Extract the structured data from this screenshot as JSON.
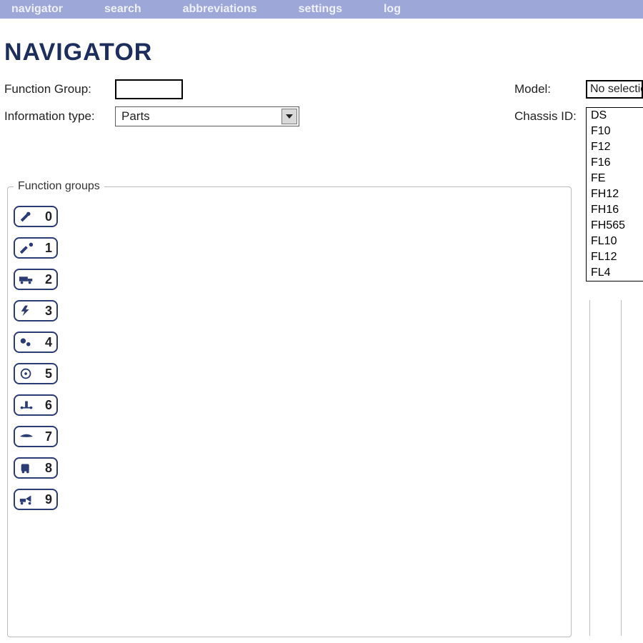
{
  "nav": {
    "items": [
      "navigator",
      "search",
      "abbreviations",
      "settings",
      "log"
    ]
  },
  "title": "NAVIGATOR",
  "labels": {
    "function_group": "Function Group:",
    "information_type": "Information type:",
    "model": "Model:",
    "chassis_id": "Chassis ID:"
  },
  "information_type_value": "Parts",
  "model_selected": "No selectio",
  "model_options": [
    "DS",
    "F10",
    "F12",
    "F16",
    "FE",
    "FH12",
    "FH16",
    "FH565",
    "FL10",
    "FL12",
    "FL4"
  ],
  "function_groups": {
    "legend": "Function groups",
    "items": [
      {
        "num": "0",
        "icon": "wrench-icon"
      },
      {
        "num": "1",
        "icon": "spanner-bolt-icon"
      },
      {
        "num": "2",
        "icon": "truck-icon"
      },
      {
        "num": "3",
        "icon": "bolt-icon"
      },
      {
        "num": "4",
        "icon": "gears-icon"
      },
      {
        "num": "5",
        "icon": "disc-icon"
      },
      {
        "num": "6",
        "icon": "axle-icon"
      },
      {
        "num": "7",
        "icon": "wing-icon"
      },
      {
        "num": "8",
        "icon": "cab-icon"
      },
      {
        "num": "9",
        "icon": "tow-truck-icon"
      }
    ]
  }
}
